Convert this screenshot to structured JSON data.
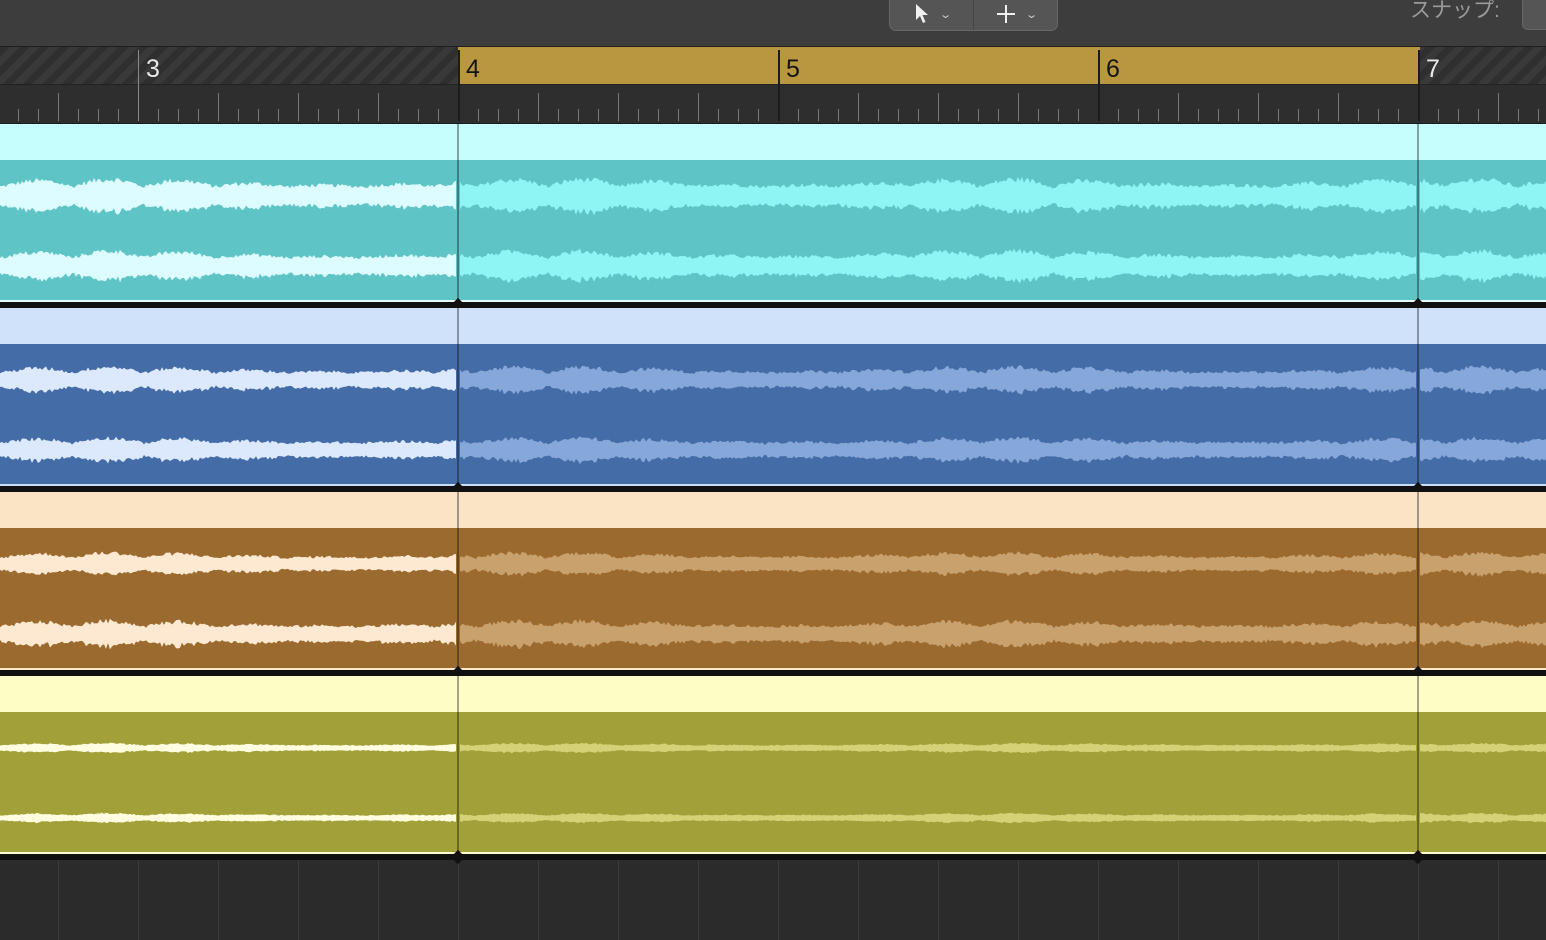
{
  "toolbar": {
    "tools": [
      {
        "name": "pointer-tool",
        "icon": "pointer-arrow-icon"
      },
      {
        "name": "marquee-tool",
        "icon": "crosshair-icon"
      }
    ],
    "snap_label": "スナップ:"
  },
  "ruler": {
    "bars": [
      "3",
      "4",
      "5",
      "6",
      "7"
    ],
    "cycle_color": "#b9973f"
  },
  "tracks": [
    {
      "name": "track-1",
      "header_color": "#c6fefe",
      "body_color": "#5fc4c6",
      "wave_before": "#ddfcff",
      "wave_after": "#8ff4f4",
      "line": "#e6ffff"
    },
    {
      "name": "track-2",
      "header_color": "#d0e2fa",
      "body_color": "#446ca6",
      "wave_before": "#dce8fc",
      "wave_after": "#86a7d9",
      "line": "#c9dcfb"
    },
    {
      "name": "track-3",
      "header_color": "#fbe3c6",
      "body_color": "#9b6a2f",
      "wave_before": "#fde9d2",
      "wave_after": "#c9a16d",
      "line": "#ffe9cf"
    },
    {
      "name": "track-4",
      "header_color": "#fefdc6",
      "body_color": "#a2a038",
      "wave_before": "#fffde0",
      "wave_after": "#d4d176",
      "line": "#fffbd0"
    }
  ]
}
